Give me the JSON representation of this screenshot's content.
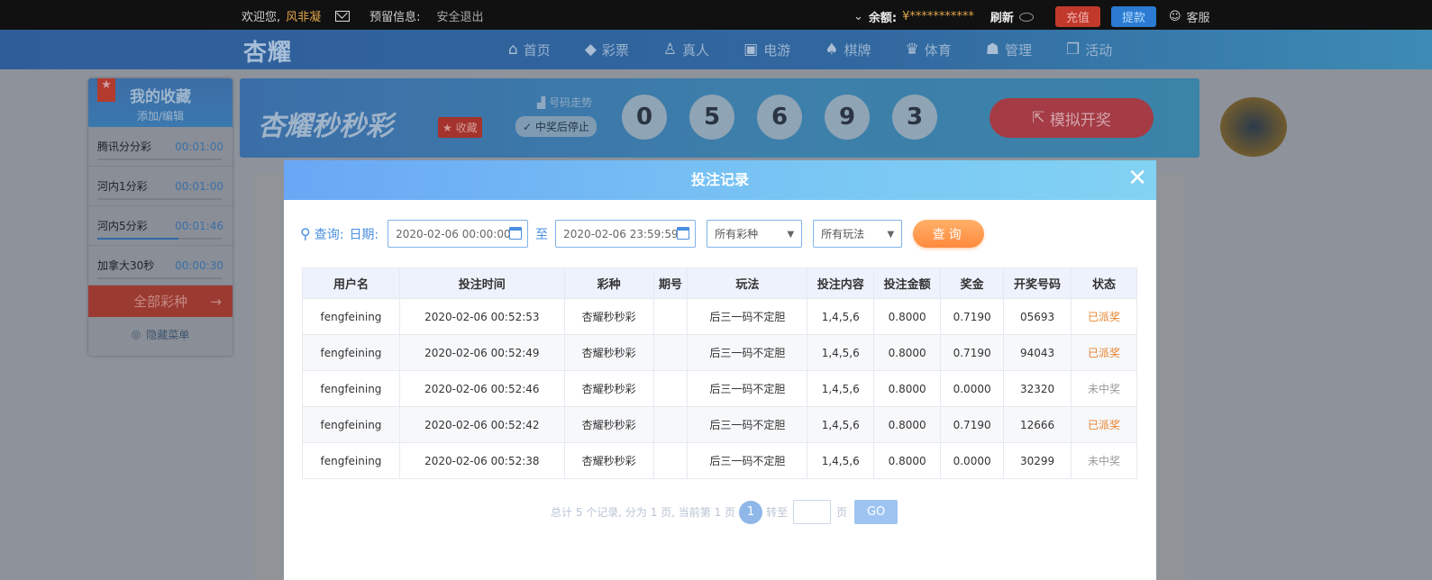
{
  "topbar": {
    "welcome": "欢迎您,",
    "username": "风非凝",
    "reserve_label": "预留信息:",
    "logout": "安全退出",
    "balance_label": "余额:",
    "balance_value": "¥***********",
    "refresh": "刷新",
    "recharge": "充值",
    "withdraw": "提款",
    "service": "客服"
  },
  "nav": {
    "logo": "杏耀",
    "items": [
      {
        "label": "首页",
        "icon": "home-icon"
      },
      {
        "label": "彩票",
        "icon": "diamond-icon"
      },
      {
        "label": "真人",
        "icon": "user-icon"
      },
      {
        "label": "电游",
        "icon": "slot-icon"
      },
      {
        "label": "棋牌",
        "icon": "poker-icon"
      },
      {
        "label": "体育",
        "icon": "trophy-icon"
      },
      {
        "label": "管理",
        "icon": "group-icon"
      },
      {
        "label": "活动",
        "icon": "gift-icon"
      }
    ]
  },
  "favorites": {
    "title": "我的收藏",
    "edit": "添加/编辑",
    "items": [
      {
        "name": "腾讯分分彩",
        "time": "00:01:00",
        "progress": 0
      },
      {
        "name": "河内1分彩",
        "time": "00:01:00",
        "progress": 0
      },
      {
        "name": "河内5分彩",
        "time": "00:01:46",
        "progress": 0.65
      },
      {
        "name": "加拿大30秒",
        "time": "00:00:30",
        "progress": 0
      }
    ],
    "all_lotteries": "全部彩种",
    "hide_menu": "隐藏菜单"
  },
  "banner": {
    "title": "杏耀秒秒彩",
    "fav_button": "收藏",
    "trend": "号码走势",
    "stop_on_win": "中奖后停止",
    "balls": [
      "0",
      "5",
      "6",
      "9",
      "3"
    ],
    "simulate": "模拟开奖"
  },
  "modal": {
    "title": "投注记录",
    "close": "✕",
    "query_label": "查询:",
    "date_label": "日期:",
    "date_from": "2020-02-06 00:00:00",
    "to": "至",
    "date_to": "2020-02-06 23:59:59",
    "lottery_select": "所有彩种",
    "play_select": "所有玩法",
    "query_button": "查询",
    "columns": [
      "用户名",
      "投注时间",
      "彩种",
      "期号",
      "玩法",
      "投注内容",
      "投注金额",
      "奖金",
      "开奖号码",
      "状态"
    ],
    "rows": [
      [
        "fengfeining",
        "2020-02-06 00:52:53",
        "杏耀秒秒彩",
        "",
        "后三一码不定胆",
        "1,4,5,6",
        "0.8000",
        "0.7190",
        "05693",
        "已派奖"
      ],
      [
        "fengfeining",
        "2020-02-06 00:52:49",
        "杏耀秒秒彩",
        "",
        "后三一码不定胆",
        "1,4,5,6",
        "0.8000",
        "0.7190",
        "94043",
        "已派奖"
      ],
      [
        "fengfeining",
        "2020-02-06 00:52:46",
        "杏耀秒秒彩",
        "",
        "后三一码不定胆",
        "1,4,5,6",
        "0.8000",
        "0.0000",
        "32320",
        "未中奖"
      ],
      [
        "fengfeining",
        "2020-02-06 00:52:42",
        "杏耀秒秒彩",
        "",
        "后三一码不定胆",
        "1,4,5,6",
        "0.8000",
        "0.7190",
        "12666",
        "已派奖"
      ],
      [
        "fengfeining",
        "2020-02-06 00:52:38",
        "杏耀秒秒彩",
        "",
        "后三一码不定胆",
        "1,4,5,6",
        "0.8000",
        "0.0000",
        "30299",
        "未中奖"
      ]
    ],
    "pager": {
      "summary": "总计 5 个记录, 分为 1 页, 当前第 1 页",
      "current": "1",
      "goto": "转至",
      "page_unit": "页",
      "go": "GO"
    }
  },
  "colors": {
    "accent": "#4a8fe0",
    "win": "#e8822d",
    "query_button": "#ff8a3c"
  }
}
